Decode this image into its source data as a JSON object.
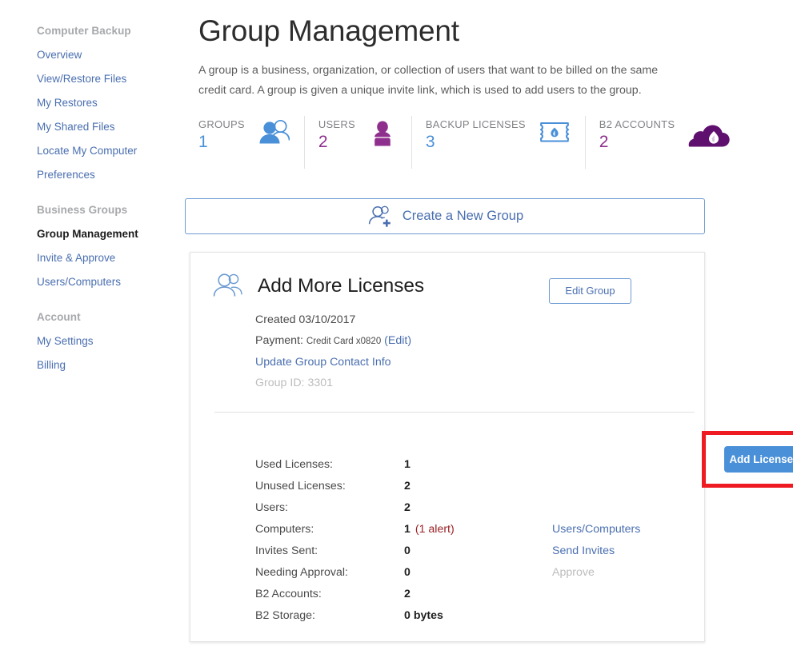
{
  "sidebar": {
    "sections": [
      {
        "heading": "Computer Backup",
        "items": [
          {
            "label": "Overview",
            "active": false
          },
          {
            "label": "View/Restore Files",
            "active": false
          },
          {
            "label": "My Restores",
            "active": false
          },
          {
            "label": "My Shared Files",
            "active": false
          },
          {
            "label": "Locate My Computer",
            "active": false
          },
          {
            "label": "Preferences",
            "active": false
          }
        ]
      },
      {
        "heading": "Business Groups",
        "items": [
          {
            "label": "Group Management",
            "active": true
          },
          {
            "label": "Invite & Approve",
            "active": false
          },
          {
            "label": "Users/Computers",
            "active": false
          }
        ]
      },
      {
        "heading": "Account",
        "items": [
          {
            "label": "My Settings",
            "active": false
          },
          {
            "label": "Billing",
            "active": false
          }
        ]
      }
    ]
  },
  "header": {
    "title": "Group Management",
    "description": "A group is a business, organization, or collection of users that want to be billed on the same credit card. A group is given a unique invite link, which is used to add users to the group."
  },
  "stats": [
    {
      "label": "GROUPS",
      "value": "1",
      "icon": "group-people-icon",
      "color": "#4a90d9"
    },
    {
      "label": "USERS",
      "value": "2",
      "icon": "user-person-icon",
      "color": "#8e2f8e"
    },
    {
      "label": "BACKUP LICENSES",
      "value": "3",
      "icon": "license-ticket-icon",
      "color": "#4a90d9"
    },
    {
      "label": "B2 ACCOUNTS",
      "value": "2",
      "icon": "b2-cloud-icon",
      "color": "#8e2f8e"
    }
  ],
  "create_group": {
    "label": "Create a New Group",
    "icon": "add-user-icon"
  },
  "group_card": {
    "icon": "group-people-outline-icon",
    "title": "Add More Licenses",
    "edit_button": "Edit Group",
    "created_label": "Created 03/10/2017",
    "payment_label": "Payment:",
    "payment_method": "Credit Card x0820",
    "payment_edit": "(Edit)",
    "contact_link": "Update Group Contact Info",
    "group_id": "Group ID: 3301",
    "rows": [
      {
        "label": "Used Licenses:",
        "value": "1",
        "note": "",
        "action": "",
        "action_disabled": false
      },
      {
        "label": "Unused Licenses:",
        "value": "2",
        "note": "",
        "action": "",
        "action_disabled": false
      },
      {
        "label": "Users:",
        "value": "2",
        "note": "",
        "action": "",
        "action_disabled": false
      },
      {
        "label": "Computers:",
        "value": "1",
        "note": "(1 alert)",
        "action": "Users/Computers",
        "action_disabled": false
      },
      {
        "label": "Invites Sent:",
        "value": "0",
        "note": "",
        "action": "Send Invites",
        "action_disabled": false
      },
      {
        "label": "Needing Approval:",
        "value": "0",
        "note": "",
        "action": "Approve",
        "action_disabled": true
      },
      {
        "label": "B2 Accounts:",
        "value": "2",
        "note": "",
        "action": "",
        "action_disabled": false
      },
      {
        "label": "B2 Storage:",
        "value": "0 bytes",
        "note": "",
        "action": "",
        "action_disabled": false
      }
    ],
    "add_licenses_button": "Add Licenses",
    "highlight_color": "#ee1c22"
  }
}
